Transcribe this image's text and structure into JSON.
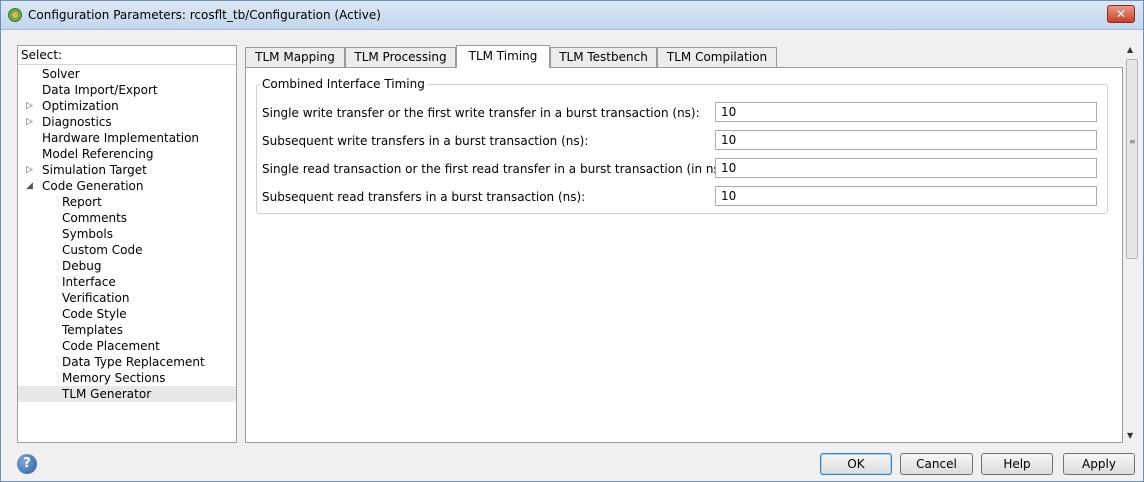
{
  "window": {
    "title": "Configuration Parameters: rcosflt_tb/Configuration (Active)",
    "close_label": "✕"
  },
  "tree": {
    "header": "Select:",
    "items": [
      {
        "label": "Solver",
        "level": 0,
        "arrow": ""
      },
      {
        "label": "Data Import/Export",
        "level": 0,
        "arrow": ""
      },
      {
        "label": "Optimization",
        "level": 0,
        "arrow": "▷"
      },
      {
        "label": "Diagnostics",
        "level": 0,
        "arrow": "▷"
      },
      {
        "label": "Hardware Implementation",
        "level": 0,
        "arrow": ""
      },
      {
        "label": "Model Referencing",
        "level": 0,
        "arrow": ""
      },
      {
        "label": "Simulation Target",
        "level": 0,
        "arrow": "▷"
      },
      {
        "label": "Code Generation",
        "level": 0,
        "arrow": "◢"
      },
      {
        "label": "Report",
        "level": 1,
        "arrow": ""
      },
      {
        "label": "Comments",
        "level": 1,
        "arrow": ""
      },
      {
        "label": "Symbols",
        "level": 1,
        "arrow": ""
      },
      {
        "label": "Custom Code",
        "level": 1,
        "arrow": ""
      },
      {
        "label": "Debug",
        "level": 1,
        "arrow": ""
      },
      {
        "label": "Interface",
        "level": 1,
        "arrow": ""
      },
      {
        "label": "Verification",
        "level": 1,
        "arrow": ""
      },
      {
        "label": "Code Style",
        "level": 1,
        "arrow": ""
      },
      {
        "label": "Templates",
        "level": 1,
        "arrow": ""
      },
      {
        "label": "Code Placement",
        "level": 1,
        "arrow": ""
      },
      {
        "label": "Data Type Replacement",
        "level": 1,
        "arrow": ""
      },
      {
        "label": "Memory Sections",
        "level": 1,
        "arrow": ""
      },
      {
        "label": "TLM Generator",
        "level": 1,
        "arrow": "",
        "selected": true
      }
    ]
  },
  "tabs": [
    {
      "label": "TLM Mapping"
    },
    {
      "label": "TLM Processing"
    },
    {
      "label": "TLM Timing",
      "active": true
    },
    {
      "label": "TLM Testbench"
    },
    {
      "label": "TLM Compilation"
    }
  ],
  "timing": {
    "group_title": "Combined Interface Timing",
    "fields": [
      {
        "label": "Single write transfer or the first write transfer in a burst transaction (ns):",
        "value": "10"
      },
      {
        "label": "Subsequent write transfers in a burst transaction (ns):",
        "value": "10"
      },
      {
        "label": "Single read transaction or the first read transfer in a burst transaction (in ns):",
        "value": "10"
      },
      {
        "label": "Subsequent read transfers in a burst transaction (ns):",
        "value": "10"
      }
    ]
  },
  "scrollbar": {
    "up": "▲",
    "down": "▼",
    "grip": "≡"
  },
  "footer": {
    "help_icon": "?",
    "ok": "OK",
    "cancel": "Cancel",
    "help": "Help",
    "apply": "Apply"
  }
}
